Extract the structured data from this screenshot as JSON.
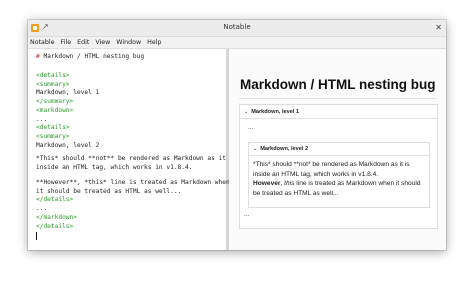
{
  "window": {
    "title": "Notable"
  },
  "menu": [
    "Notable",
    "File",
    "Edit",
    "View",
    "Window",
    "Help"
  ],
  "editor": {
    "heading_mark": "#",
    "heading_text": "Markdown / HTML nesting bug",
    "lines": [
      "<details>",
      "<summary>",
      "Markdown, level 1",
      "</summary>",
      "<markdown>",
      "...",
      "<details>",
      "<summary>",
      "Markdown, level 2",
      "*This* should **not** be rendered as Markdown as it is",
      "inside an HTML tag, which works in v1.8.4.",
      "**However**, *this* line is treated as Markdown when",
      "it should be treated as HTML as well...",
      "</details>",
      "...",
      "</markdown>",
      "</details>"
    ]
  },
  "preview": {
    "title": "Markdown / HTML nesting bug",
    "outer_summary": "Markdown, level 1",
    "inner_summary": "Markdown, level 2",
    "inner_line1": "*This* should **not* be rendered as Markdown as it is inside an HTML tag, which works in v1.8.4.",
    "inner_bold": "However",
    "inner_sep": ", ",
    "inner_em": "this",
    "inner_rest": " line is treated as Markdown when it should be treated as HTML as well...",
    "ellipsis_top": "...",
    "ellipsis_bottom": "..."
  }
}
